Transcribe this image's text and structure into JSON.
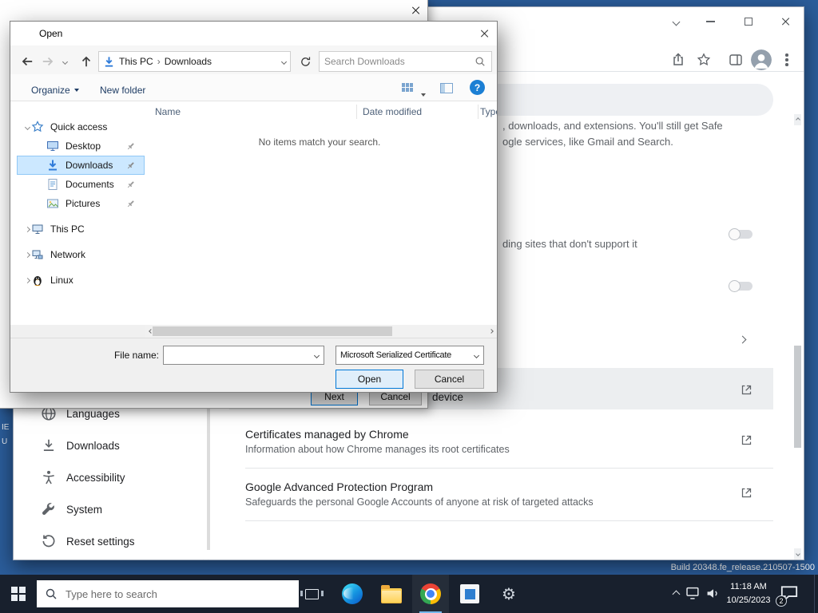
{
  "desktop": {
    "background_color": "#2b5d9b",
    "build_watermark": "Build 20348.fe_release.210507-1500",
    "icon_label_fragments": [
      "IE",
      "U"
    ]
  },
  "icons": {
    "gear_glyph": "⚙",
    "help_glyph": "?"
  },
  "wizard": {
    "buttons": {
      "next": "Next",
      "cancel": "Cancel"
    }
  },
  "open_dialog": {
    "title": "Open",
    "nav": {
      "breadcrumb": {
        "root": "This PC",
        "current": "Downloads",
        "separator": "›"
      },
      "search_placeholder": "Search Downloads"
    },
    "command_bar": {
      "organize": "Organize",
      "new_folder": "New folder"
    },
    "columns": {
      "name": "Name",
      "date_modified": "Date modified",
      "type": "Type"
    },
    "empty_message": "No items match your search.",
    "sidebar": {
      "items": [
        {
          "label": "Quick access",
          "icon": "star"
        },
        {
          "label": "Desktop",
          "icon": "monitor"
        },
        {
          "label": "Downloads",
          "icon": "download-arrow"
        },
        {
          "label": "Documents",
          "icon": "document"
        },
        {
          "label": "Pictures",
          "icon": "picture"
        },
        {
          "label": "This PC",
          "icon": "computer"
        },
        {
          "label": "Network",
          "icon": "network"
        },
        {
          "label": "Linux",
          "icon": "penguin"
        }
      ]
    },
    "footer": {
      "file_name_label": "File name:",
      "file_name_value": "",
      "file_type_value": "Microsoft Serialized Certificate",
      "open_button": "Open",
      "cancel_button": "Cancel"
    }
  },
  "chrome": {
    "settings": {
      "sidebar_items": [
        {
          "label": "Languages",
          "icon": "globe"
        },
        {
          "label": "Downloads",
          "icon": "download"
        },
        {
          "label": "Accessibility",
          "icon": "accessibility"
        },
        {
          "label": "System",
          "icon": "wrench"
        },
        {
          "label": "Reset settings",
          "icon": "reset"
        }
      ],
      "fragments": {
        "safe_browsing_line1": ", downloads, and extensions. You'll still get Safe",
        "safe_browsing_line2": "ogle services, like Gmail and Search.",
        "secure_connections": "ding sites that don't support it",
        "manage_device": "device"
      },
      "rows": [
        {
          "title": "Certificates managed by Chrome",
          "subtitle": "Information about how Chrome manages its root certificates"
        },
        {
          "title": "Google Advanced Protection Program",
          "subtitle": "Safeguards the personal Google Accounts of anyone at risk of targeted attacks"
        }
      ]
    }
  },
  "taskbar": {
    "search_placeholder": "Type here to search",
    "clock": {
      "time": "11:18 AM",
      "date": "10/25/2023"
    },
    "notification_badge": "2"
  }
}
